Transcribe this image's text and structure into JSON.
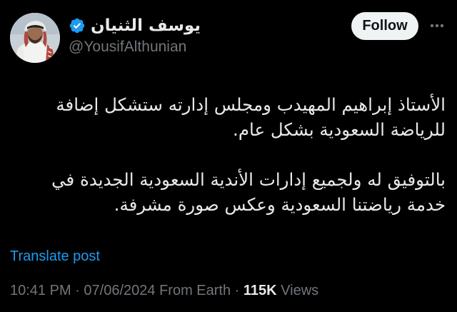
{
  "author": {
    "display_name": "يوسف الثنيان",
    "handle": "@YousifAlthunian",
    "verified": true,
    "avatar_icon": "profile-photo"
  },
  "actions": {
    "follow_label": "Follow",
    "more_icon": "more-horizontal-icon"
  },
  "tweet": {
    "paragraphs": [
      "الأستاذ إبراهيم المهيدب ومجلس إدارته ستشكل إضافة للرياضة السعودية بشكل عام.",
      "بالتوفيق له ولجميع إدارات الأندية السعودية الجديدة في خدمة رياضتنا السعودية وعكس صورة مشرفة."
    ],
    "translate_label": "Translate post"
  },
  "meta": {
    "time": "10:41 PM",
    "separator": " · ",
    "date": "07/06/2024",
    "source": "From Earth",
    "views_count": "115K",
    "views_label": " Views"
  },
  "colors": {
    "background": "#000000",
    "text_primary": "#e7e9ea",
    "text_secondary": "#71767b",
    "link": "#1d9bf0",
    "verified_badge": "#1d9bf0",
    "follow_bg": "#eff3f4"
  }
}
